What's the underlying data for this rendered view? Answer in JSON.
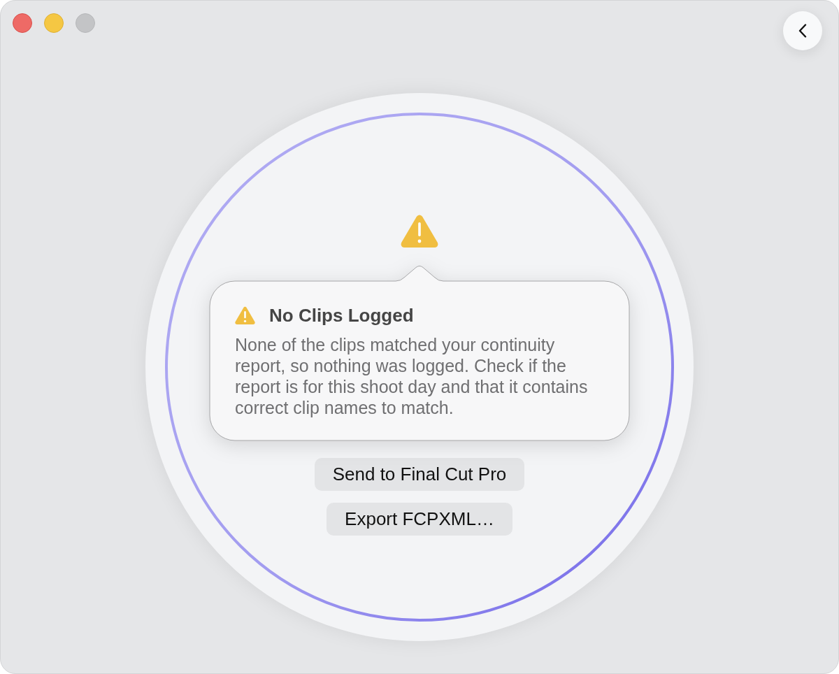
{
  "window": {
    "controls": [
      {
        "kind": "close",
        "disabled": false
      },
      {
        "kind": "minimize",
        "disabled": false
      },
      {
        "kind": "zoom",
        "disabled": true
      }
    ],
    "back_button": true
  },
  "status": {
    "kind": "warning",
    "progress": {
      "level": 1
    }
  },
  "popover": {
    "kind": "warning",
    "title": "No Clips Logged",
    "message": "None of the clips matched your continuity report, so nothing was logged. Check if the report is for this shoot day and that it contains correct clip names to match."
  },
  "buttons": [
    {
      "label": "Send to Final Cut Pro"
    },
    {
      "label": "Export FCPXML…"
    }
  ]
}
